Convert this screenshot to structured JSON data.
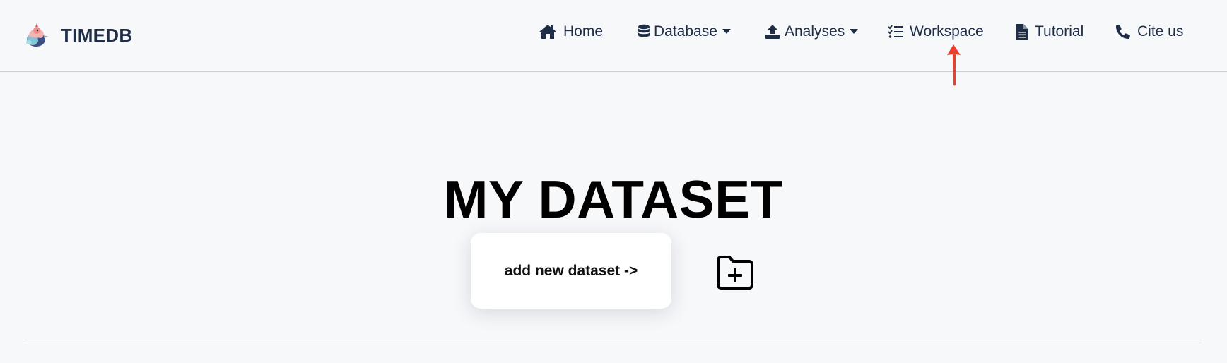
{
  "brand": {
    "name": "TIMEDB",
    "logo_icon": "bird-logo-icon"
  },
  "nav": {
    "items": [
      {
        "label": "Home",
        "icon": "home-icon",
        "dropdown": false
      },
      {
        "label": "Database",
        "icon": "database-icon",
        "dropdown": true
      },
      {
        "label": "Analyses",
        "icon": "upload-icon",
        "dropdown": true
      },
      {
        "label": "Workspace",
        "icon": "checklist-icon",
        "dropdown": false
      },
      {
        "label": "Tutorial",
        "icon": "document-icon",
        "dropdown": false
      },
      {
        "label": "Cite us",
        "icon": "phone-icon",
        "dropdown": false
      }
    ]
  },
  "annotation": {
    "arrow_color": "#e8412c",
    "points_to": "Workspace"
  },
  "main": {
    "title": "MY DATASET",
    "add_button_label": "add new dataset ->",
    "folder_icon": "folder-plus-icon"
  },
  "colors": {
    "nav_text": "#1f2d47",
    "background": "#f7f8fa",
    "title": "#000000"
  }
}
